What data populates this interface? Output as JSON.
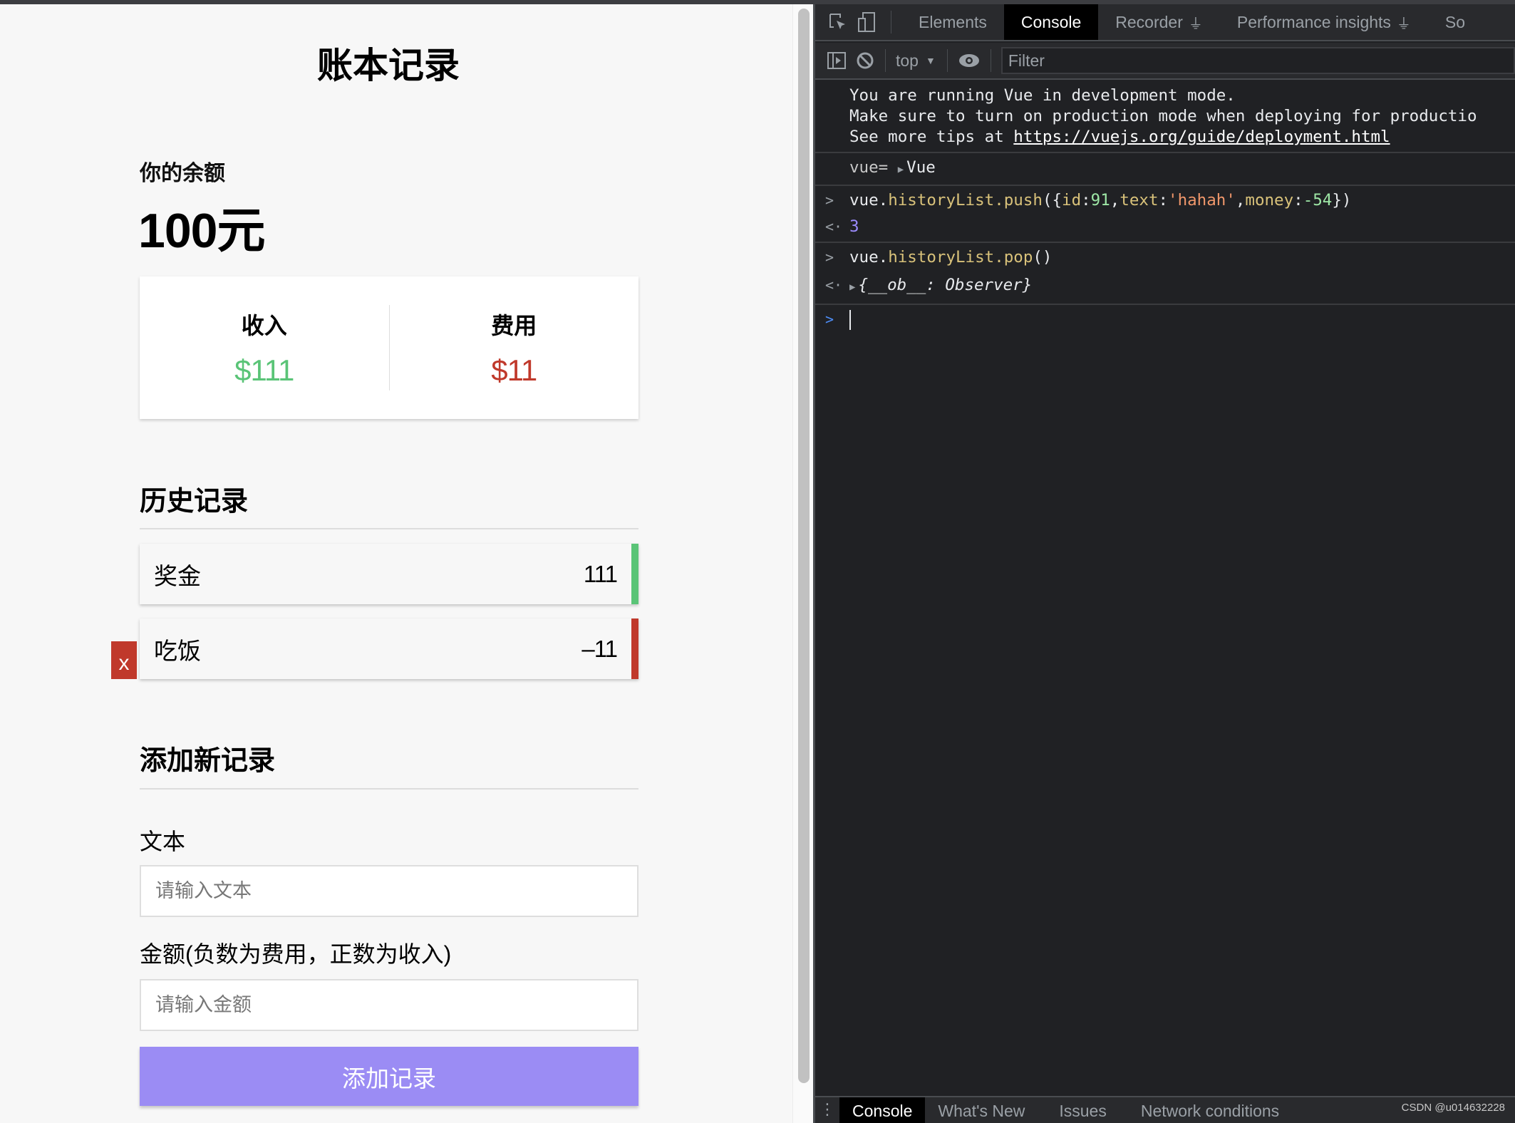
{
  "page": {
    "title": "账本记录",
    "balance": {
      "label": "你的余额",
      "value": "100元"
    },
    "summary": {
      "income": {
        "label": "收入",
        "amount": "$111",
        "color": "#5ac477"
      },
      "expense": {
        "label": "费用",
        "amount": "$11",
        "color": "#c0392b"
      }
    },
    "history": {
      "title": "历史记录",
      "items": [
        {
          "text": "奖金",
          "amount": "111",
          "type": "plus",
          "color": "#5ac477"
        },
        {
          "text": "吃饭",
          "amount": "–11",
          "type": "minus",
          "color": "#c0392b",
          "delete_label": "x"
        }
      ]
    },
    "add_form": {
      "title": "添加新记录",
      "text_label": "文本",
      "text_placeholder": "请输入文本",
      "text_value": "",
      "amount_label": "金额(负数为费用，正数为收入)",
      "amount_placeholder": "请输入金额",
      "amount_value": "",
      "submit_label": "添加记录",
      "submit_color": "#9b8cf4"
    }
  },
  "devtools": {
    "tabs": [
      {
        "label": "Elements",
        "active": false
      },
      {
        "label": "Console",
        "active": true
      },
      {
        "label": "Recorder",
        "active": false,
        "experimental": true
      },
      {
        "label": "Performance insights",
        "active": false,
        "experimental": true
      },
      {
        "label": "So",
        "active": false
      }
    ],
    "icons": {
      "inspect": "inspect-element-icon",
      "device": "device-toolbar-icon",
      "sidebar": "show-sidebar-icon",
      "clear": "clear-console-icon",
      "eye": "live-expression-icon",
      "flask": "experiment-flask-icon"
    },
    "toolbar": {
      "context": "top",
      "filter_placeholder": "Filter"
    },
    "console": {
      "vue_warning": {
        "line1": "You are running Vue in development mode.",
        "line2": "Make sure to turn on production mode when deploying for productio",
        "line3_prefix": "See more tips at ",
        "link": "https://vuejs.org/guide/deployment.html"
      },
      "log_vue": {
        "prefix": "vue= ",
        "object": "Vue"
      },
      "cmd1": {
        "obj": "vue.",
        "prop": "historyList",
        "method": ".push",
        "open": "({",
        "k1": "id",
        "v1": "91",
        "k2": "text",
        "v2": "'hahah'",
        "k3": "money",
        "v3": "-54",
        "close": "})",
        "result": "3"
      },
      "cmd2": {
        "obj": "vue.",
        "prop": "historyList",
        "method": ".pop",
        "call": "()",
        "result": "{__ob__: Observer}"
      }
    },
    "drawer": {
      "tabs": [
        {
          "label": "Console",
          "active": true
        },
        {
          "label": "What's New",
          "active": false
        },
        {
          "label": "Issues",
          "active": false
        },
        {
          "label": "Network conditions",
          "active": false
        }
      ]
    },
    "watermark": "CSDN @u014632228"
  }
}
